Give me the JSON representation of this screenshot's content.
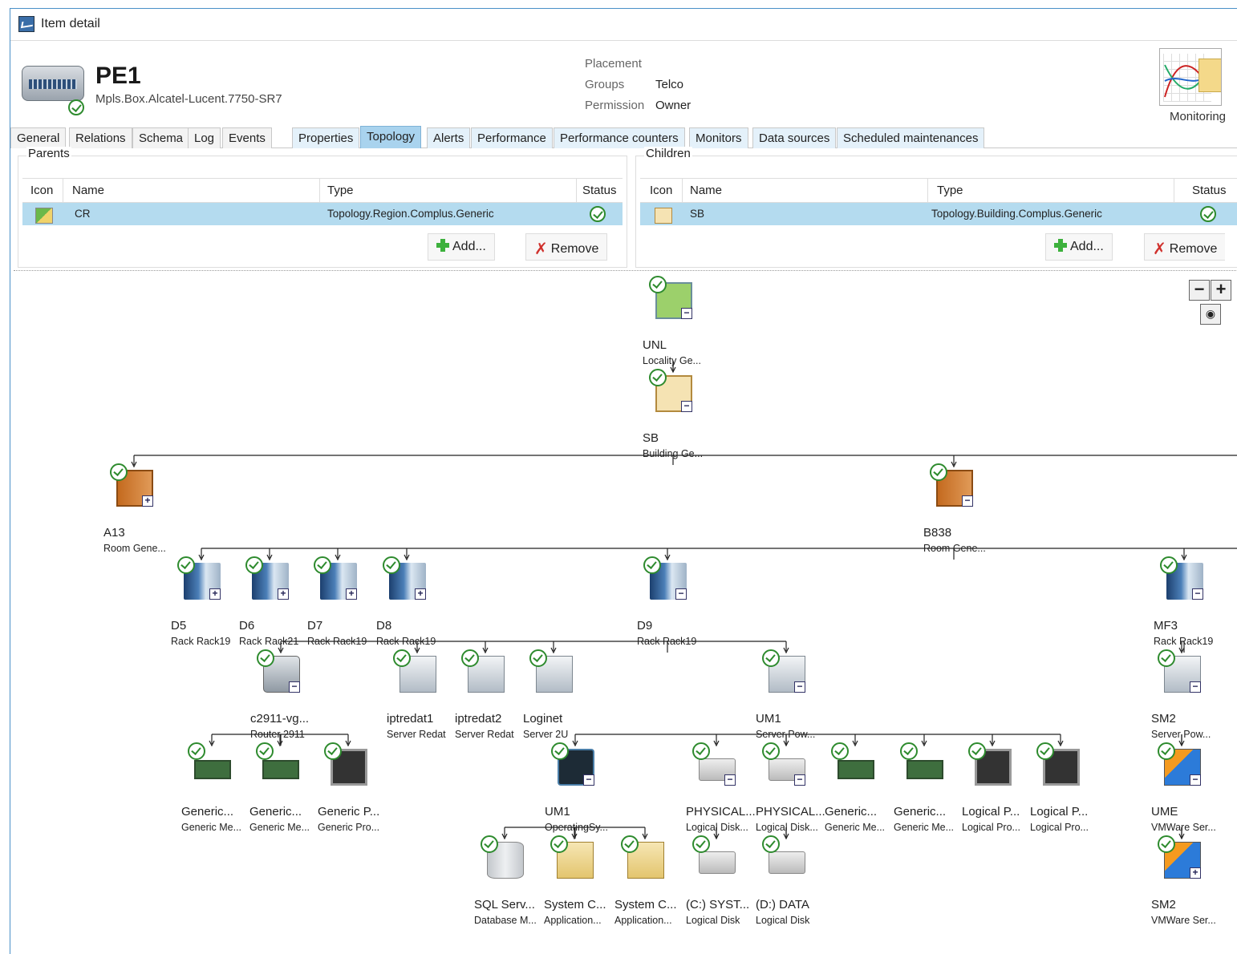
{
  "window": {
    "title": "Item detail"
  },
  "header": {
    "name": "PE1",
    "type": "Mpls.Box.Alcatel-Lucent.7750-SR7",
    "meta": [
      {
        "k": "Placement",
        "v": ""
      },
      {
        "k": "Groups",
        "v": "Telco"
      },
      {
        "k": "Permission",
        "v": "Owner"
      }
    ],
    "monitoring_label": "Monitoring"
  },
  "tabs": [
    "General",
    "Relations",
    "Schema",
    "Log",
    "Events",
    "Properties",
    "Topology",
    "Alerts",
    "Performance",
    "Performance counters",
    "Monitors",
    "Data sources",
    "Scheduled maintenances"
  ],
  "parents": {
    "title": "Parents",
    "cols": [
      "Icon",
      "Name",
      "Type",
      "Status"
    ],
    "row": {
      "name": "CR",
      "type": "Topology.Region.Complus.Generic"
    },
    "add": "Add...",
    "remove": "Remove"
  },
  "children": {
    "title": "Children",
    "cols": [
      "Icon",
      "Name",
      "Type",
      "Status"
    ],
    "row": {
      "name": "SB",
      "type": "Topology.Building.Complus.Generic"
    },
    "add": "Add...",
    "remove": "Remove"
  },
  "zoom": {
    "out": "−",
    "in": "+"
  },
  "nodes": [
    {
      "id": "UNL",
      "name": "UNL",
      "type": "Locality Ge...",
      "icon": "map-icon",
      "toggle": "−"
    },
    {
      "id": "SB",
      "name": "SB",
      "type": "Building Ge...",
      "icon": "house-icon",
      "toggle": "−"
    },
    {
      "id": "A13",
      "name": "A13",
      "type": "Room Gene...",
      "icon": "door-icon",
      "toggle": "+"
    },
    {
      "id": "B838",
      "name": "B838",
      "type": "Room Gene...",
      "icon": "door-icon",
      "toggle": "−"
    },
    {
      "id": "D5",
      "name": "D5",
      "type": "Rack Rack19",
      "icon": "server-icon",
      "toggle": "+"
    },
    {
      "id": "D6",
      "name": "D6",
      "type": "Rack Rack21",
      "icon": "server-icon",
      "toggle": "+"
    },
    {
      "id": "D7",
      "name": "D7",
      "type": "Rack Rack19",
      "icon": "server-icon",
      "toggle": "+"
    },
    {
      "id": "D8",
      "name": "D8",
      "type": "Rack Rack19",
      "icon": "server-icon",
      "toggle": "+"
    },
    {
      "id": "D9",
      "name": "D9",
      "type": "Rack Rack19",
      "icon": "server-icon",
      "toggle": "−"
    },
    {
      "id": "MF3",
      "name": "MF3",
      "type": "Rack Rack19",
      "icon": "server-icon",
      "toggle": "−"
    },
    {
      "id": "c2911",
      "name": "c2911-vg...",
      "type": "Router 2911",
      "icon": "router-icon",
      "toggle": "−"
    },
    {
      "id": "ip1",
      "name": "iptredat1",
      "type": "Server Redat",
      "icon": "blade-icon",
      "toggle": ""
    },
    {
      "id": "ip2",
      "name": "iptredat2",
      "type": "Server Redat",
      "icon": "blade-icon",
      "toggle": ""
    },
    {
      "id": "login",
      "name": "Loginet",
      "type": "Server 2U",
      "icon": "blade-icon",
      "toggle": ""
    },
    {
      "id": "UM1s",
      "name": "UM1",
      "type": "Server Pow...",
      "icon": "blade-icon",
      "toggle": "−"
    },
    {
      "id": "SM2s",
      "name": "SM2",
      "type": "Server Pow...",
      "icon": "blade-icon",
      "toggle": "−"
    },
    {
      "id": "g1",
      "name": "Generic...",
      "type": "Generic Me...",
      "icon": "memory-icon",
      "toggle": ""
    },
    {
      "id": "g2",
      "name": "Generic...",
      "type": "Generic Me...",
      "icon": "memory-icon",
      "toggle": ""
    },
    {
      "id": "g3",
      "name": "Generic P...",
      "type": "Generic Pro...",
      "icon": "cpu-icon",
      "toggle": ""
    },
    {
      "id": "UM1os",
      "name": "UM1",
      "type": "OperatingSy...",
      "icon": "console-icon",
      "toggle": "−"
    },
    {
      "id": "pd1",
      "name": "PHYSICAL...",
      "type": "Logical Disk...",
      "icon": "disk-icon",
      "toggle": "−"
    },
    {
      "id": "pd2",
      "name": "PHYSICAL...",
      "type": "Logical Disk...",
      "icon": "disk-icon",
      "toggle": "−"
    },
    {
      "id": "g4",
      "name": "Generic...",
      "type": "Generic Me...",
      "icon": "memory-icon",
      "toggle": ""
    },
    {
      "id": "g5",
      "name": "Generic...",
      "type": "Generic Me...",
      "icon": "memory-icon",
      "toggle": ""
    },
    {
      "id": "lp1",
      "name": "Logical P...",
      "type": "Logical Pro...",
      "icon": "cpu-icon",
      "toggle": ""
    },
    {
      "id": "lp2",
      "name": "Logical P...",
      "type": "Logical Pro...",
      "icon": "cpu-icon",
      "toggle": ""
    },
    {
      "id": "UME",
      "name": "UME",
      "type": "VMWare Ser...",
      "icon": "vmware-icon",
      "toggle": "−"
    },
    {
      "id": "sql",
      "name": "SQL Serv...",
      "type": "Database M...",
      "icon": "database-icon",
      "toggle": ""
    },
    {
      "id": "sc1",
      "name": "System C...",
      "type": "Application...",
      "icon": "app-icon",
      "toggle": ""
    },
    {
      "id": "sc2",
      "name": "System C...",
      "type": "Application...",
      "icon": "app-icon",
      "toggle": ""
    },
    {
      "id": "cdisk",
      "name": "(C:) SYST...",
      "type": "Logical Disk",
      "icon": "disk-icon",
      "toggle": ""
    },
    {
      "id": "ddisk",
      "name": "(D:) DATA",
      "type": "Logical Disk",
      "icon": "disk-icon",
      "toggle": ""
    },
    {
      "id": "SM2v",
      "name": "SM2",
      "type": "VMWare Ser...",
      "icon": "vmware-icon",
      "toggle": "+"
    }
  ]
}
